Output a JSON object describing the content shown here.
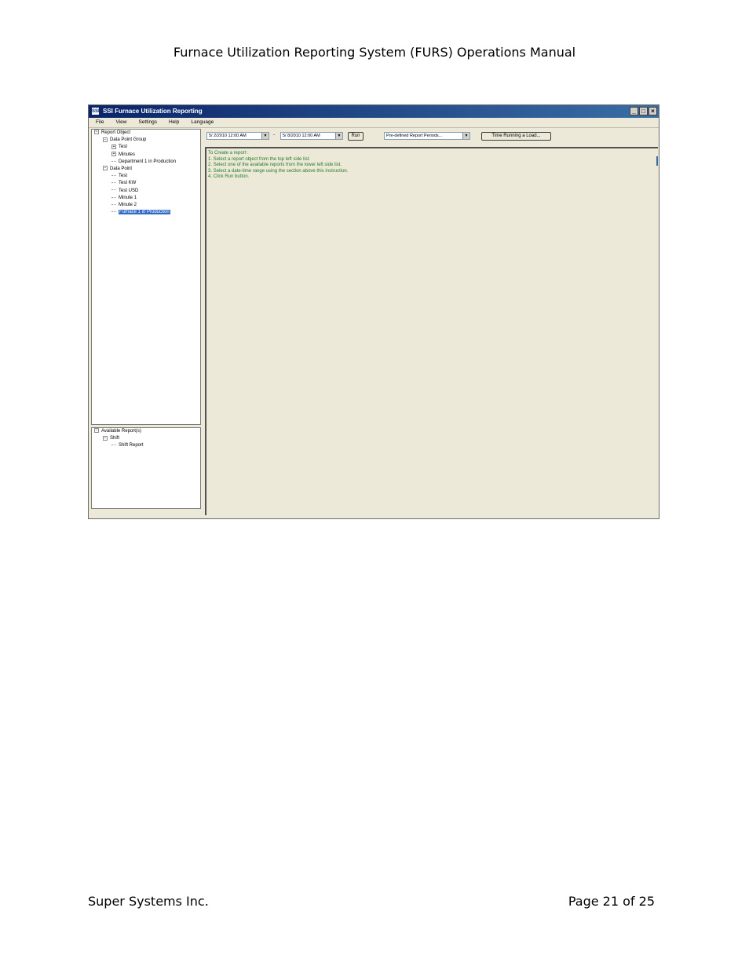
{
  "document": {
    "header": "Furnace Utilization Reporting System (FURS) Operations Manual",
    "footer_left": "Super Systems Inc.",
    "footer_right": "Page 21 of 25"
  },
  "app": {
    "title": "SSI Furnace Utilization Reporting",
    "icon_text": "SSI",
    "menu": [
      "File",
      "View",
      "Settings",
      "Help",
      "Language"
    ],
    "report_tree": {
      "root": "Report Object",
      "group": "Data Point Group",
      "group_items": [
        "Test",
        "Minutes",
        "Department 1 in Production"
      ],
      "datapoint": "Data Point",
      "datapoint_items": [
        "Test",
        "Test KW",
        "Test USD",
        "Minute 1",
        "Minute 2",
        "Furnace 1 in Production"
      ]
    },
    "available_tree": {
      "root": "Available Report(s)",
      "group": "Shift",
      "items": [
        "Shift Report"
      ]
    },
    "toolbar": {
      "start_date": "5/ 2/2010 12:00 AM",
      "separator": "-",
      "end_date": "5/ 8/2010 12:00 AM",
      "run_label": "Run",
      "periods_placeholder": "Pre-defined Report Periods...",
      "time_running_label": "Time Running a Load..."
    },
    "instructions": [
      "To Create a report :",
      "1. Select a report object from the top left side list.",
      "2. Select one of the available reports from the lower left side list.",
      "3. Select a date-time range using the section above this instruction.",
      "4. Click Run button."
    ],
    "colors": {
      "titlebar_start": "#0a246a",
      "titlebar_end": "#3a6ea5",
      "selection": "#316ac5",
      "instruction_text": "#2a7a2a",
      "window_bg": "#ece9d8"
    }
  }
}
